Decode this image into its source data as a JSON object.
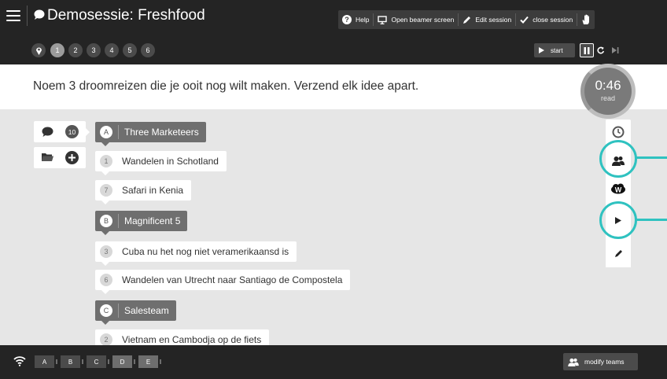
{
  "app": {
    "title": "Demosessie: Freshfood"
  },
  "toolbar": {
    "help_label": "Help",
    "beamer_label": "Open beamer screen",
    "edit_label": "Edit session",
    "close_label": "close session"
  },
  "questions": [
    "1",
    "2",
    "3",
    "4",
    "5",
    "6"
  ],
  "active_question": "1",
  "controls": {
    "start_label": "start"
  },
  "question": {
    "text": "Noem 3 droomreizen die je ooit nog wilt maken. Verzend elk idee apart."
  },
  "timer": {
    "time": "0:46",
    "label": "read"
  },
  "count": {
    "ideas": "10"
  },
  "list": {
    "team_a": {
      "letter": "A",
      "name": "Three Marketeers"
    },
    "idea_1": {
      "num": "1",
      "text": "Wandelen in Schotland"
    },
    "idea_2": {
      "num": "7",
      "text": "Safari in Kenia"
    },
    "team_b": {
      "letter": "B",
      "name": "Magnificent 5"
    },
    "idea_3": {
      "num": "3",
      "text": "Cuba nu het nog niet veramerikaansd is"
    },
    "idea_4": {
      "num": "6",
      "text": "Wandelen van Utrecht naar Santiago de Compostela"
    },
    "team_c": {
      "letter": "C",
      "name": "Salesteam"
    },
    "idea_5": {
      "num": "2",
      "text": "Vietnam en Cambodja op de fiets"
    }
  },
  "right_toolbar": {
    "wordcloud_badge": "W"
  },
  "bottom": {
    "teams": [
      "A",
      "B",
      "C",
      "D",
      "E"
    ],
    "modify_label": "modify teams"
  },
  "colors": {
    "highlight": "#2fc2c0",
    "topbar": "#242424",
    "team_header": "#6f6f6f"
  },
  "icons": [
    "menu-icon",
    "chat-bubble-icon",
    "question-icon",
    "monitor-icon",
    "pencil-icon",
    "check-icon",
    "hand-icon",
    "pin-icon",
    "play-icon",
    "pause-icon",
    "reset-icon",
    "skip-icon",
    "folder-icon",
    "plus-icon",
    "clock-icon",
    "team-icon",
    "cloud-icon",
    "wifi-icon"
  ]
}
